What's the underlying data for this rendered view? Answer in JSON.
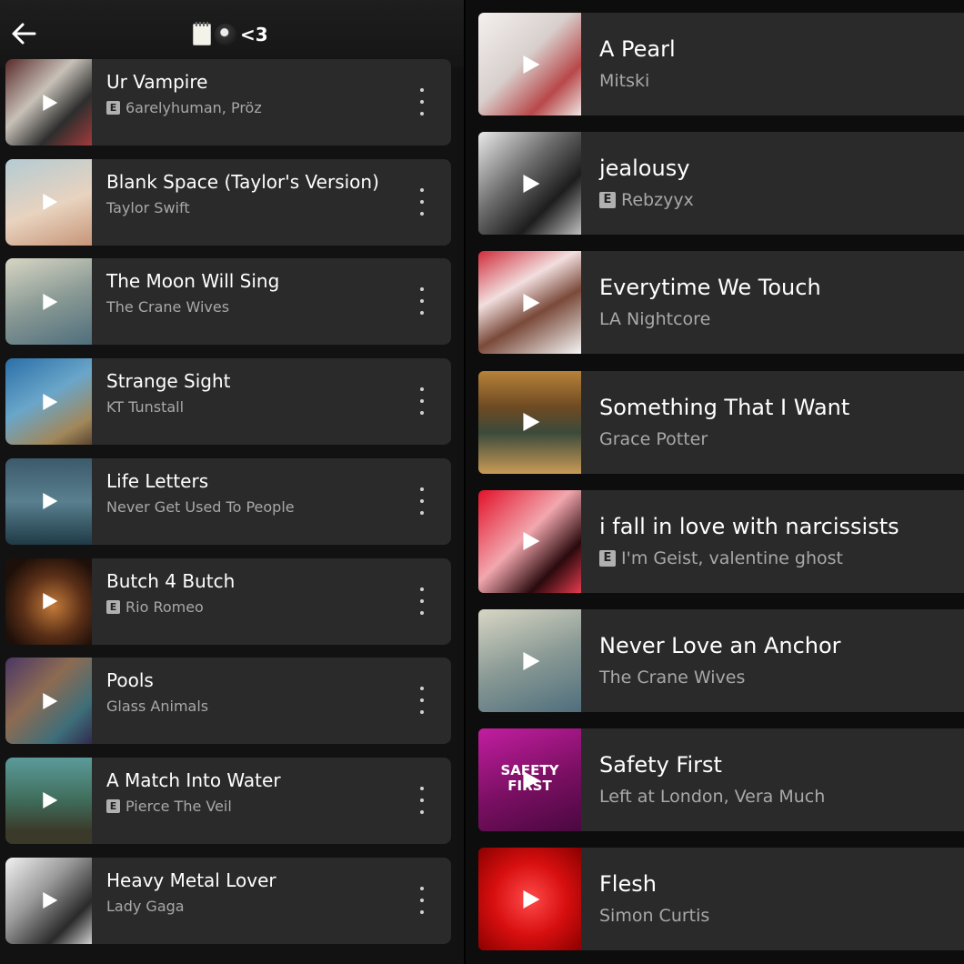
{
  "header": {
    "title_text": "<3",
    "title_emojis": [
      "notepad-icon",
      "8-ball-icon"
    ]
  },
  "left_tracks": [
    {
      "title": "Ur Vampire",
      "artist": "6arelyhuman, Pröz",
      "explicit": true,
      "art": "linear-gradient(135deg,#5a2a2a,#c7c1b8 40%,#2e2e2e 70%,#a23a3a)"
    },
    {
      "title": "Blank Space (Taylor's Version)",
      "artist": "Taylor Swift",
      "explicit": false,
      "art": "linear-gradient(160deg,#b4cbd3,#e8d3bf 55%,#c79578)"
    },
    {
      "title": "The Moon Will Sing",
      "artist": "The Crane Wives",
      "explicit": false,
      "art": "linear-gradient(160deg,#d8d6c4,#8a9a95 50%,#4f6e7c)"
    },
    {
      "title": "Strange Sight",
      "artist": "KT Tunstall",
      "explicit": false,
      "art": "linear-gradient(150deg,#2a6fa8,#6aa6c9 45%,#a1875a 80%,#5b4630)"
    },
    {
      "title": "Life Letters",
      "artist": "Never Get Used To People",
      "explicit": false,
      "art": "linear-gradient(180deg,#3c5a6b,#59808f 50%,#1f3a46)"
    },
    {
      "title": "Butch 4 Butch",
      "artist": "Rio Romeo",
      "explicit": true,
      "art": "radial-gradient(circle at 55% 55%,#c37b3a,#5a2f17 45%,#1d0f09 80%)"
    },
    {
      "title": "Pools",
      "artist": "Glass Animals",
      "explicit": false,
      "art": "linear-gradient(135deg,#4a3766,#8d6b52 40%,#3e6e79 75%,#302b4f)"
    },
    {
      "title": "A Match Into Water",
      "artist": "Pierce The Veil",
      "explicit": true,
      "art": "linear-gradient(180deg,#5c9b9a,#3f6c5a 50%,#3b3a2a 85%)"
    },
    {
      "title": "Heavy Metal Lover",
      "artist": "Lady Gaga",
      "explicit": false,
      "art": "linear-gradient(135deg,#f2f2f2,#9a9a9a 40%,#2a2a2a 75%,#cfcfcf)"
    }
  ],
  "right_tracks": [
    {
      "title": "A Pearl",
      "artist": "Mitski",
      "explicit": false,
      "art": "linear-gradient(135deg,#f4f0ee,#d8cfcc 45%,#b8484a 75%,#efe6e3)"
    },
    {
      "title": "jealousy",
      "artist": "Rebzyyx",
      "explicit": true,
      "art": "linear-gradient(135deg,#e9e9e9,#6d6d6d 40%,#1d1d1d 70%,#bfbfbf)"
    },
    {
      "title": "Everytime We Touch",
      "artist": "LA Nightcore",
      "explicit": false,
      "art": "linear-gradient(150deg,#cf2d3b,#f2dede 35%,#7a4a3a 60%,#f5f5f5)"
    },
    {
      "title": "Something That I Want",
      "artist": "Grace Potter",
      "explicit": false,
      "art": "linear-gradient(180deg,#b7823a,#6e4a22 35%,#3b4a3a 60%,#c99b56)"
    },
    {
      "title": "i fall in love with narcissists",
      "artist": "I'm Geist, valentine ghost",
      "explicit": true,
      "art": "linear-gradient(135deg,#e2122a,#f2a7ae 45%,#2a0a0d 75%,#e53a4e)"
    },
    {
      "title": "Never Love an Anchor",
      "artist": "The Crane Wives",
      "explicit": false,
      "art": "linear-gradient(160deg,#d8d6c4,#8a9a95 50%,#4f6e7c)"
    },
    {
      "title": "Safety First",
      "artist": "Left at London, Vera Much",
      "explicit": false,
      "art": "linear-gradient(160deg,#c21ea0,#7a0f62 55%,#4a0840)",
      "art_text": "SAFETY FIRST"
    },
    {
      "title": "Flesh",
      "artist": "Simon Curtis",
      "explicit": false,
      "art": "radial-gradient(circle at 50% 50%,#ff4a4a,#d80f0f 50%,#8a0000)"
    }
  ],
  "labels": {
    "explicit_badge": "E"
  }
}
